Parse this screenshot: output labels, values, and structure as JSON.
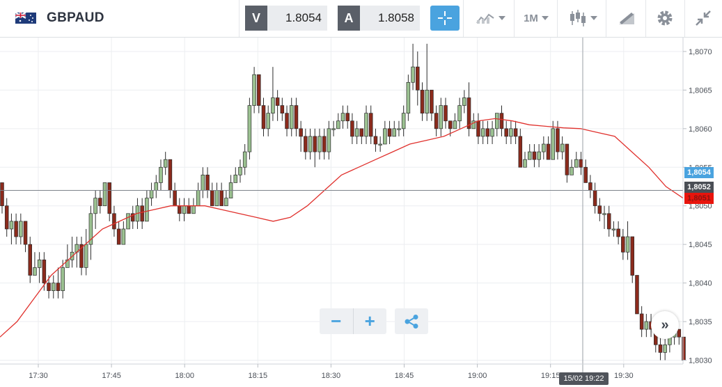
{
  "header": {
    "symbol": "GBPAUD",
    "bid_letter": "V",
    "bid_value": "1.8054",
    "ask_letter": "A",
    "ask_value": "1.8058",
    "timeframe": "1M",
    "icons": [
      "flag-uk-au-icon",
      "crosshair-icon",
      "line-chart-icon",
      "candlestick-icon",
      "drawing-tools-icon",
      "gear-icon",
      "collapse-icon"
    ]
  },
  "colors": {
    "accent": "#4aa3df",
    "bull": "#9bc191",
    "bear": "#8b2a1c",
    "ma": "#e0302c",
    "bid_tag": "#4aa3df",
    "ask_tag": "#e8140c",
    "current_tag": "#4a4e55"
  },
  "price_tags": {
    "bid": "1,8054",
    "current": "1,8052",
    "red": "1,8051"
  },
  "crosshair_time": "15/02 19:22",
  "controls": {
    "zoom_out": "−",
    "zoom_in": "+",
    "scroll_right": "»"
  },
  "chart_data": {
    "type": "candlestick",
    "x_ticks": [
      "17:30",
      "17:45",
      "18:00",
      "18:15",
      "18:30",
      "18:45",
      "19:00",
      "19:15",
      "19:30"
    ],
    "y_ticks": [
      "1,8070",
      "1,8065",
      "1,8060",
      "1,8055",
      "1,8050",
      "1,8045",
      "1,8040",
      "1,8035",
      "1,8030"
    ],
    "ylim": [
      1.80295,
      1.80718
    ],
    "crosshair_price": 1.8052,
    "candles": [
      [
        1.8053,
        1.805,
        1.8053,
        1.8049
      ],
      [
        1.805,
        1.8047,
        1.8051,
        1.8046
      ],
      [
        1.8047,
        1.8048,
        1.8049,
        1.8045
      ],
      [
        1.8048,
        1.8046,
        1.8049,
        1.8045
      ],
      [
        1.8046,
        1.8048,
        1.8049,
        1.8045
      ],
      [
        1.8048,
        1.8045,
        1.8048,
        1.8044
      ],
      [
        1.8045,
        1.8041,
        1.8046,
        1.804
      ],
      [
        1.8041,
        1.8042,
        1.8044,
        1.8041
      ],
      [
        1.8042,
        1.8043,
        1.8044,
        1.804
      ],
      [
        1.8043,
        1.804,
        1.8044,
        1.8039
      ],
      [
        1.804,
        1.8039,
        1.8041,
        1.8038
      ],
      [
        1.8039,
        1.804,
        1.8041,
        1.8038
      ],
      [
        1.804,
        1.8039,
        1.8042,
        1.8038
      ],
      [
        1.8039,
        1.8042,
        1.8043,
        1.8038
      ],
      [
        1.8042,
        1.8043,
        1.8045,
        1.8042
      ],
      [
        1.8043,
        1.8044,
        1.8046,
        1.8042
      ],
      [
        1.8044,
        1.8045,
        1.8046,
        1.8042
      ],
      [
        1.8045,
        1.8042,
        1.8046,
        1.8041
      ],
      [
        1.8042,
        1.8045,
        1.8047,
        1.8041
      ],
      [
        1.8045,
        1.8049,
        1.805,
        1.8043
      ],
      [
        1.8049,
        1.8051,
        1.8052,
        1.8047
      ],
      [
        1.8051,
        1.805,
        1.8052,
        1.8049
      ],
      [
        1.805,
        1.8053,
        1.8053,
        1.805
      ],
      [
        1.8053,
        1.8049,
        1.8053,
        1.8048
      ],
      [
        1.8049,
        1.8047,
        1.805,
        1.8046
      ],
      [
        1.8047,
        1.8045,
        1.8048,
        1.8045
      ],
      [
        1.8045,
        1.8047,
        1.8048,
        1.8045
      ],
      [
        1.8047,
        1.8049,
        1.8049,
        1.8047
      ],
      [
        1.8049,
        1.8048,
        1.805,
        1.8047
      ],
      [
        1.8048,
        1.805,
        1.8051,
        1.8047
      ],
      [
        1.805,
        1.8048,
        1.8051,
        1.8047
      ],
      [
        1.8048,
        1.8051,
        1.8052,
        1.8048
      ],
      [
        1.8051,
        1.8052,
        1.8053,
        1.805
      ],
      [
        1.8052,
        1.8053,
        1.8054,
        1.8051
      ],
      [
        1.8053,
        1.8055,
        1.8056,
        1.8052
      ],
      [
        1.8055,
        1.8056,
        1.8057,
        1.8054
      ],
      [
        1.8056,
        1.8052,
        1.8056,
        1.8051
      ],
      [
        1.8052,
        1.805,
        1.8053,
        1.805
      ],
      [
        1.805,
        1.8049,
        1.8051,
        1.8048
      ],
      [
        1.8049,
        1.805,
        1.8051,
        1.8048
      ],
      [
        1.805,
        1.8049,
        1.8051,
        1.8049
      ],
      [
        1.8049,
        1.805,
        1.8051,
        1.8049
      ],
      [
        1.805,
        1.8052,
        1.8053,
        1.805
      ],
      [
        1.8052,
        1.8054,
        1.8055,
        1.8051
      ],
      [
        1.8054,
        1.8052,
        1.8055,
        1.8051
      ],
      [
        1.8052,
        1.805,
        1.8053,
        1.805
      ],
      [
        1.805,
        1.8052,
        1.8053,
        1.805
      ],
      [
        1.8052,
        1.805,
        1.8053,
        1.805
      ],
      [
        1.805,
        1.8051,
        1.8052,
        1.805
      ],
      [
        1.8051,
        1.8053,
        1.8054,
        1.8051
      ],
      [
        1.8053,
        1.8054,
        1.8055,
        1.8053
      ],
      [
        1.8054,
        1.8055,
        1.8056,
        1.8053
      ],
      [
        1.8055,
        1.8057,
        1.8058,
        1.8054
      ],
      [
        1.8057,
        1.8063,
        1.8064,
        1.8056
      ],
      [
        1.8063,
        1.8067,
        1.8068,
        1.8062
      ],
      [
        1.8067,
        1.8063,
        1.8067,
        1.8062
      ],
      [
        1.8063,
        1.806,
        1.8064,
        1.8059
      ],
      [
        1.806,
        1.8062,
        1.8063,
        1.8059
      ],
      [
        1.8062,
        1.8064,
        1.8068,
        1.8061
      ],
      [
        1.8064,
        1.8063,
        1.8065,
        1.8061
      ],
      [
        1.8063,
        1.8062,
        1.8064,
        1.8061
      ],
      [
        1.8062,
        1.806,
        1.8063,
        1.8059
      ],
      [
        1.806,
        1.8063,
        1.8064,
        1.8059
      ],
      [
        1.8063,
        1.806,
        1.8064,
        1.8059
      ],
      [
        1.806,
        1.8059,
        1.8061,
        1.8057
      ],
      [
        1.8059,
        1.8057,
        1.806,
        1.8056
      ],
      [
        1.8057,
        1.8059,
        1.806,
        1.8056
      ],
      [
        1.8059,
        1.8057,
        1.806,
        1.8055
      ],
      [
        1.8057,
        1.8059,
        1.806,
        1.8056
      ],
      [
        1.8059,
        1.8057,
        1.806,
        1.8056
      ],
      [
        1.8057,
        1.806,
        1.8061,
        1.8056
      ],
      [
        1.806,
        1.806,
        1.8061,
        1.8059
      ],
      [
        1.806,
        1.8061,
        1.8062,
        1.806
      ],
      [
        1.8061,
        1.8062,
        1.8063,
        1.806
      ],
      [
        1.8062,
        1.8061,
        1.8063,
        1.806
      ],
      [
        1.8061,
        1.8059,
        1.8062,
        1.8058
      ],
      [
        1.8059,
        1.806,
        1.8061,
        1.8058
      ],
      [
        1.806,
        1.8059,
        1.806,
        1.8058
      ],
      [
        1.8059,
        1.8062,
        1.8063,
        1.8058
      ],
      [
        1.8062,
        1.8059,
        1.8063,
        1.8058
      ],
      [
        1.8059,
        1.8058,
        1.806,
        1.8057
      ],
      [
        1.8058,
        1.8058,
        1.8059,
        1.8057
      ],
      [
        1.8058,
        1.806,
        1.8061,
        1.8058
      ],
      [
        1.806,
        1.8059,
        1.8061,
        1.8058
      ],
      [
        1.8059,
        1.806,
        1.8061,
        1.8059
      ],
      [
        1.806,
        1.806,
        1.8061,
        1.8059
      ],
      [
        1.806,
        1.8062,
        1.8063,
        1.8059
      ],
      [
        1.8062,
        1.8066,
        1.8067,
        1.8061
      ],
      [
        1.8066,
        1.8068,
        1.8071,
        1.8065
      ],
      [
        1.8068,
        1.8065,
        1.807,
        1.8063
      ],
      [
        1.8065,
        1.8062,
        1.8066,
        1.8061
      ],
      [
        1.8062,
        1.8065,
        1.8071,
        1.8061
      ],
      [
        1.8065,
        1.8062,
        1.8065,
        1.8061
      ],
      [
        1.8062,
        1.806,
        1.8063,
        1.8059
      ],
      [
        1.806,
        1.8063,
        1.8064,
        1.8059
      ],
      [
        1.8063,
        1.8061,
        1.8064,
        1.806
      ],
      [
        1.8061,
        1.806,
        1.8061,
        1.8059
      ],
      [
        1.806,
        1.8061,
        1.8062,
        1.806
      ],
      [
        1.8061,
        1.8063,
        1.8064,
        1.806
      ],
      [
        1.8063,
        1.8064,
        1.8065,
        1.8062
      ],
      [
        1.8064,
        1.806,
        1.8066,
        1.8059
      ],
      [
        1.806,
        1.8061,
        1.8062,
        1.806
      ],
      [
        1.8061,
        1.8059,
        1.8062,
        1.8058
      ],
      [
        1.8059,
        1.806,
        1.8061,
        1.8058
      ],
      [
        1.806,
        1.8059,
        1.8061,
        1.8058
      ],
      [
        1.8059,
        1.806,
        1.8061,
        1.8058
      ],
      [
        1.806,
        1.8062,
        1.8062,
        1.8059
      ],
      [
        1.8062,
        1.806,
        1.8063,
        1.8059
      ],
      [
        1.806,
        1.8059,
        1.8061,
        1.8058
      ],
      [
        1.8059,
        1.806,
        1.8061,
        1.8058
      ],
      [
        1.806,
        1.8059,
        1.8061,
        1.8058
      ],
      [
        1.8059,
        1.8055,
        1.806,
        1.8055
      ],
      [
        1.8055,
        1.8056,
        1.8057,
        1.8055
      ],
      [
        1.8056,
        1.8057,
        1.8058,
        1.8056
      ],
      [
        1.8057,
        1.8056,
        1.8058,
        1.8055
      ],
      [
        1.8056,
        1.8057,
        1.8058,
        1.8055
      ],
      [
        1.8057,
        1.8058,
        1.8059,
        1.8056
      ],
      [
        1.8058,
        1.8056,
        1.8059,
        1.8056
      ],
      [
        1.8056,
        1.806,
        1.8061,
        1.8056
      ],
      [
        1.806,
        1.8057,
        1.8061,
        1.8056
      ],
      [
        1.8057,
        1.8058,
        1.8059,
        1.8056
      ],
      [
        1.8058,
        1.8054,
        1.8058,
        1.8053
      ],
      [
        1.8054,
        1.8055,
        1.8056,
        1.8054
      ],
      [
        1.8055,
        1.8056,
        1.8057,
        1.8055
      ],
      [
        1.8056,
        1.8055,
        1.8057,
        1.8054
      ],
      [
        1.8055,
        1.8053,
        1.8056,
        1.8053
      ],
      [
        1.8053,
        1.8052,
        1.8054,
        1.8051
      ],
      [
        1.8052,
        1.805,
        1.8053,
        1.8049
      ],
      [
        1.805,
        1.8049,
        1.8051,
        1.8048
      ],
      [
        1.8049,
        1.8049,
        1.805,
        1.8047
      ],
      [
        1.8049,
        1.8047,
        1.805,
        1.8046
      ],
      [
        1.8047,
        1.8047,
        1.8048,
        1.8046
      ],
      [
        1.8047,
        1.8046,
        1.8048,
        1.8045
      ],
      [
        1.8046,
        1.8044,
        1.8047,
        1.8043
      ],
      [
        1.8044,
        1.8046,
        1.8048,
        1.8043
      ],
      [
        1.8046,
        1.8041,
        1.8046,
        1.804
      ],
      [
        1.8041,
        1.8036,
        1.8041,
        1.8036
      ],
      [
        1.8036,
        1.8034,
        1.8037,
        1.8033
      ],
      [
        1.8034,
        1.8035,
        1.8036,
        1.8033
      ],
      [
        1.8035,
        1.8034,
        1.8036,
        1.8033
      ],
      [
        1.8034,
        1.8032,
        1.8035,
        1.8031
      ],
      [
        1.8032,
        1.8031,
        1.8033,
        1.803
      ],
      [
        1.8031,
        1.8032,
        1.8033,
        1.803
      ],
      [
        1.8032,
        1.8033,
        1.8034,
        1.8031
      ],
      [
        1.8033,
        1.8034,
        1.8035,
        1.8032
      ],
      [
        1.8034,
        1.8033,
        1.8034,
        1.8032
      ],
      [
        1.8033,
        1.803,
        1.8033,
        1.803
      ]
    ],
    "ma": [
      1.8033,
      1.8035,
      1.8038,
      1.8041,
      1.8043,
      1.8045,
      1.8047,
      1.8048,
      1.8049,
      1.80495,
      1.805,
      1.805,
      1.805,
      1.80495,
      1.8049,
      1.80485,
      1.8048,
      1.80485,
      1.805,
      1.8052,
      1.8054,
      1.8055,
      1.8056,
      1.8057,
      1.8058,
      1.80585,
      1.8059,
      1.806,
      1.8061,
      1.80613,
      1.8061,
      1.80605,
      1.80603,
      1.80601,
      1.806,
      1.80595,
      1.8059,
      1.8057,
      1.8055,
      1.80525,
      1.8051
    ]
  }
}
